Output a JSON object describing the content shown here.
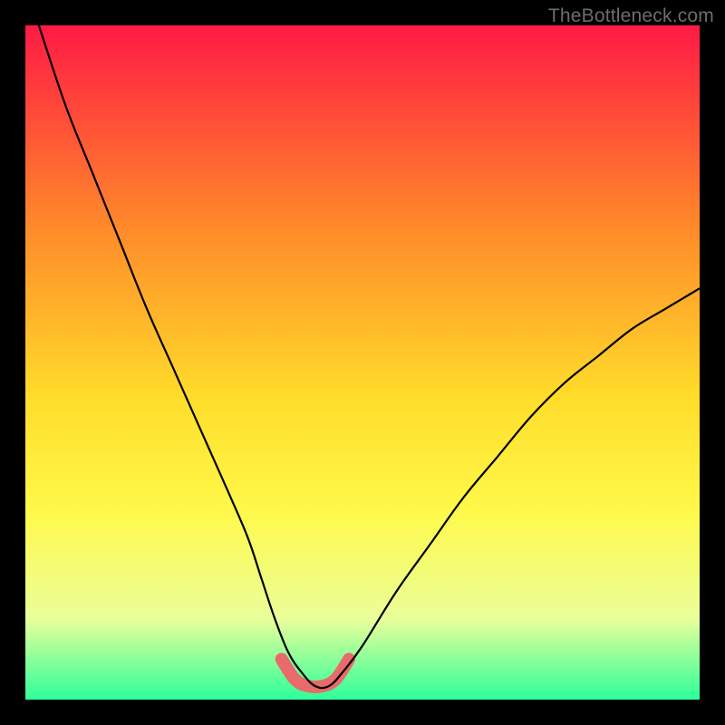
{
  "watermark": "TheBottleneck.com",
  "colors": {
    "bg_black": "#000000",
    "grad_top": "#ff1a45",
    "grad_mid1": "#ff8a2a",
    "grad_mid2": "#ffdc2a",
    "grad_mid3": "#fff94a",
    "grad_low": "#eaff9a",
    "grad_bottom": "#2dff9a",
    "curve": "#000000",
    "bump": "#e96a6a",
    "watermark": "#6d6d6d"
  },
  "chart_data": {
    "type": "line",
    "title": "",
    "xlabel": "",
    "ylabel": "",
    "xlim": [
      0,
      100
    ],
    "ylim": [
      0,
      100
    ],
    "series": [
      {
        "name": "bottleneck-curve",
        "x": [
          2,
          6,
          10,
          14,
          18,
          22,
          26,
          30,
          33,
          35,
          37,
          39,
          41,
          43,
          45,
          47,
          50,
          55,
          60,
          65,
          70,
          75,
          80,
          85,
          90,
          95,
          100
        ],
        "values": [
          100,
          88,
          78,
          68,
          58,
          49,
          40,
          31,
          24,
          18,
          12,
          7,
          4,
          2,
          2,
          4,
          8,
          16,
          23,
          30,
          36,
          42,
          47,
          51,
          55,
          58,
          61
        ]
      },
      {
        "name": "optimal-range-highlight",
        "x": [
          38,
          40,
          42,
          44,
          46,
          48
        ],
        "values": [
          6,
          3,
          2,
          2,
          3,
          6
        ]
      }
    ],
    "annotations": [
      {
        "text": "TheBottleneck.com",
        "pos": "top-right"
      }
    ],
    "gradient_stops": [
      {
        "offset": 0.0,
        "color": "#ff1a45"
      },
      {
        "offset": 0.3,
        "color": "#ff8a2a"
      },
      {
        "offset": 0.55,
        "color": "#ffdc2a"
      },
      {
        "offset": 0.72,
        "color": "#fff94a"
      },
      {
        "offset": 0.88,
        "color": "#eaff9a"
      },
      {
        "offset": 1.0,
        "color": "#2dff9a"
      }
    ]
  }
}
